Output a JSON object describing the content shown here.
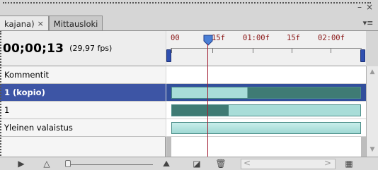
{
  "window": {
    "minimize_glyph": "–",
    "close_glyph": "×",
    "menu_glyph": "▾≡"
  },
  "tabs": [
    {
      "label": "kajana)",
      "close": "×",
      "active": true
    },
    {
      "label": "Mittausloki",
      "active": false
    }
  ],
  "timecode": {
    "value": "00;00;13",
    "fps": "(29,97 fps)"
  },
  "ruler": {
    "labels": [
      "00",
      "15f",
      "01:00f",
      "15f",
      "02:00f"
    ]
  },
  "layers": [
    {
      "name": "Kommentit",
      "selected": false
    },
    {
      "name": "1 (kopio)",
      "selected": true
    },
    {
      "name": "1",
      "selected": false
    },
    {
      "name": "Yleinen valaistus",
      "selected": false
    }
  ],
  "colors": {
    "selection": "#3d55a5",
    "playhead": "#a22035",
    "clip_light": "#a8ddd8",
    "clip_dark": "#3f7b74"
  },
  "toolbar": {
    "play_icon": "▶",
    "zoom_out_icon": "△",
    "zoom_in_icon": "⛰",
    "new_layer_icon": "◪",
    "delete_icon": "🗑",
    "scroll_left": "<",
    "scroll_right": ">",
    "frames_icon": "▦"
  }
}
